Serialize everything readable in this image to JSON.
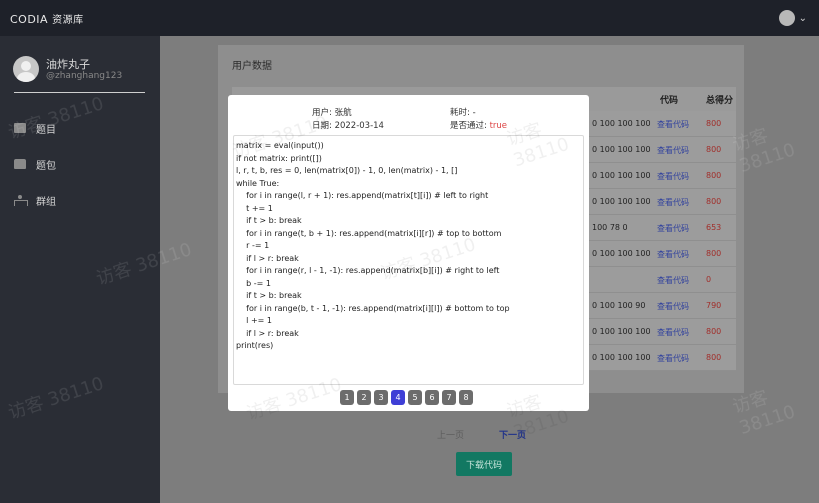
{
  "app": {
    "brand": "CODIA",
    "brand_sub": "资源库"
  },
  "user": {
    "name": "油炸丸子",
    "handle": "@zhanghang123"
  },
  "sidebar": {
    "items": [
      {
        "label": "题目"
      },
      {
        "label": "题包"
      },
      {
        "label": "群组"
      }
    ]
  },
  "main": {
    "title": "用户数据",
    "columns": [
      "代码",
      "总得分"
    ],
    "rows": [
      {
        "scores": "0 100 100 100",
        "code": "查看代码",
        "total": "800"
      },
      {
        "scores": "0 100 100 100",
        "code": "查看代码",
        "total": "800"
      },
      {
        "scores": "0 100 100 100",
        "code": "查看代码",
        "total": "800"
      },
      {
        "scores": "0 100 100 100",
        "code": "查看代码",
        "total": "800"
      },
      {
        "scores": "100 78 0",
        "code": "查看代码",
        "total": "653"
      },
      {
        "scores": "0 100 100 100",
        "code": "查看代码",
        "total": "800"
      },
      {
        "scores": "",
        "code": "查看代码",
        "total": "0"
      },
      {
        "scores": "0 100 100 90",
        "code": "查看代码",
        "total": "790"
      },
      {
        "scores": "0 100 100 100",
        "code": "查看代码",
        "total": "800"
      },
      {
        "scores": "0 100 100 100",
        "code": "查看代码",
        "total": "800"
      }
    ],
    "prev_label": "上一页",
    "next_label": "下一页",
    "download_label": "下载代码"
  },
  "modal": {
    "user_label": "用户: 张航",
    "date_label": "日期: 2022-03-14",
    "time_label": "耗时: -",
    "pass_label": "是否通过:",
    "pass_value": "true",
    "code_lines": [
      "matrix = eval(input())",
      "if not matrix: print([])",
      "l, r, t, b, res = 0, len(matrix[0]) - 1, 0, len(matrix) - 1, []",
      "while True:",
      "    for i in range(l, r + 1): res.append(matrix[t][i]) # left to right",
      "    t += 1",
      "    if t > b: break",
      "    for i in range(t, b + 1): res.append(matrix[i][r]) # top to bottom",
      "    r -= 1",
      "    if l > r: break",
      "    for i in range(r, l - 1, -1): res.append(matrix[b][i]) # right to left",
      "    b -= 1",
      "    if t > b: break",
      "    for i in range(b, t - 1, -1): res.append(matrix[i][l]) # bottom to top",
      "    l += 1",
      "    if l > r: break",
      "print(res)"
    ],
    "pages": [
      "1",
      "2",
      "3",
      "4",
      "5",
      "6",
      "7",
      "8"
    ],
    "active_page": "4"
  },
  "watermark": "访客 38110"
}
